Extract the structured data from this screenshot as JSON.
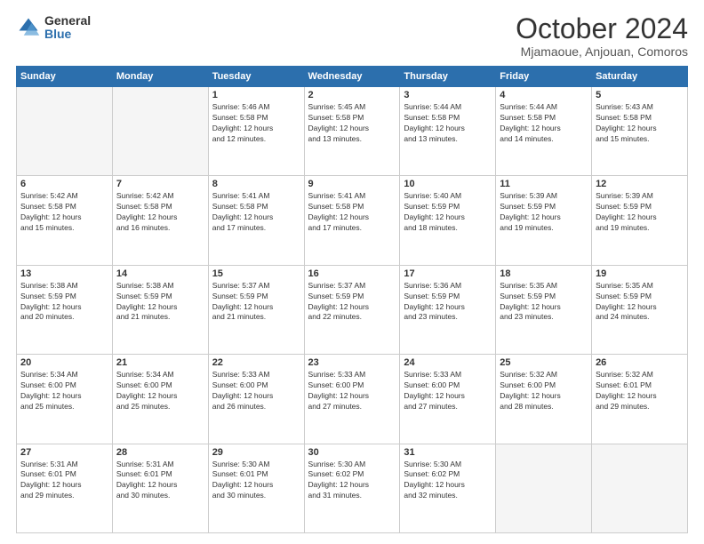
{
  "logo": {
    "general": "General",
    "blue": "Blue"
  },
  "title": {
    "month_year": "October 2024",
    "location": "Mjamaoue, Anjouan, Comoros"
  },
  "weekdays": [
    "Sunday",
    "Monday",
    "Tuesday",
    "Wednesday",
    "Thursday",
    "Friday",
    "Saturday"
  ],
  "weeks": [
    [
      {
        "day": "",
        "details": ""
      },
      {
        "day": "",
        "details": ""
      },
      {
        "day": "1",
        "details": "Sunrise: 5:46 AM\nSunset: 5:58 PM\nDaylight: 12 hours\nand 12 minutes."
      },
      {
        "day": "2",
        "details": "Sunrise: 5:45 AM\nSunset: 5:58 PM\nDaylight: 12 hours\nand 13 minutes."
      },
      {
        "day": "3",
        "details": "Sunrise: 5:44 AM\nSunset: 5:58 PM\nDaylight: 12 hours\nand 13 minutes."
      },
      {
        "day": "4",
        "details": "Sunrise: 5:44 AM\nSunset: 5:58 PM\nDaylight: 12 hours\nand 14 minutes."
      },
      {
        "day": "5",
        "details": "Sunrise: 5:43 AM\nSunset: 5:58 PM\nDaylight: 12 hours\nand 15 minutes."
      }
    ],
    [
      {
        "day": "6",
        "details": "Sunrise: 5:42 AM\nSunset: 5:58 PM\nDaylight: 12 hours\nand 15 minutes."
      },
      {
        "day": "7",
        "details": "Sunrise: 5:42 AM\nSunset: 5:58 PM\nDaylight: 12 hours\nand 16 minutes."
      },
      {
        "day": "8",
        "details": "Sunrise: 5:41 AM\nSunset: 5:58 PM\nDaylight: 12 hours\nand 17 minutes."
      },
      {
        "day": "9",
        "details": "Sunrise: 5:41 AM\nSunset: 5:58 PM\nDaylight: 12 hours\nand 17 minutes."
      },
      {
        "day": "10",
        "details": "Sunrise: 5:40 AM\nSunset: 5:59 PM\nDaylight: 12 hours\nand 18 minutes."
      },
      {
        "day": "11",
        "details": "Sunrise: 5:39 AM\nSunset: 5:59 PM\nDaylight: 12 hours\nand 19 minutes."
      },
      {
        "day": "12",
        "details": "Sunrise: 5:39 AM\nSunset: 5:59 PM\nDaylight: 12 hours\nand 19 minutes."
      }
    ],
    [
      {
        "day": "13",
        "details": "Sunrise: 5:38 AM\nSunset: 5:59 PM\nDaylight: 12 hours\nand 20 minutes."
      },
      {
        "day": "14",
        "details": "Sunrise: 5:38 AM\nSunset: 5:59 PM\nDaylight: 12 hours\nand 21 minutes."
      },
      {
        "day": "15",
        "details": "Sunrise: 5:37 AM\nSunset: 5:59 PM\nDaylight: 12 hours\nand 21 minutes."
      },
      {
        "day": "16",
        "details": "Sunrise: 5:37 AM\nSunset: 5:59 PM\nDaylight: 12 hours\nand 22 minutes."
      },
      {
        "day": "17",
        "details": "Sunrise: 5:36 AM\nSunset: 5:59 PM\nDaylight: 12 hours\nand 23 minutes."
      },
      {
        "day": "18",
        "details": "Sunrise: 5:35 AM\nSunset: 5:59 PM\nDaylight: 12 hours\nand 23 minutes."
      },
      {
        "day": "19",
        "details": "Sunrise: 5:35 AM\nSunset: 5:59 PM\nDaylight: 12 hours\nand 24 minutes."
      }
    ],
    [
      {
        "day": "20",
        "details": "Sunrise: 5:34 AM\nSunset: 6:00 PM\nDaylight: 12 hours\nand 25 minutes."
      },
      {
        "day": "21",
        "details": "Sunrise: 5:34 AM\nSunset: 6:00 PM\nDaylight: 12 hours\nand 25 minutes."
      },
      {
        "day": "22",
        "details": "Sunrise: 5:33 AM\nSunset: 6:00 PM\nDaylight: 12 hours\nand 26 minutes."
      },
      {
        "day": "23",
        "details": "Sunrise: 5:33 AM\nSunset: 6:00 PM\nDaylight: 12 hours\nand 27 minutes."
      },
      {
        "day": "24",
        "details": "Sunrise: 5:33 AM\nSunset: 6:00 PM\nDaylight: 12 hours\nand 27 minutes."
      },
      {
        "day": "25",
        "details": "Sunrise: 5:32 AM\nSunset: 6:00 PM\nDaylight: 12 hours\nand 28 minutes."
      },
      {
        "day": "26",
        "details": "Sunrise: 5:32 AM\nSunset: 6:01 PM\nDaylight: 12 hours\nand 29 minutes."
      }
    ],
    [
      {
        "day": "27",
        "details": "Sunrise: 5:31 AM\nSunset: 6:01 PM\nDaylight: 12 hours\nand 29 minutes."
      },
      {
        "day": "28",
        "details": "Sunrise: 5:31 AM\nSunset: 6:01 PM\nDaylight: 12 hours\nand 30 minutes."
      },
      {
        "day": "29",
        "details": "Sunrise: 5:30 AM\nSunset: 6:01 PM\nDaylight: 12 hours\nand 30 minutes."
      },
      {
        "day": "30",
        "details": "Sunrise: 5:30 AM\nSunset: 6:02 PM\nDaylight: 12 hours\nand 31 minutes."
      },
      {
        "day": "31",
        "details": "Sunrise: 5:30 AM\nSunset: 6:02 PM\nDaylight: 12 hours\nand 32 minutes."
      },
      {
        "day": "",
        "details": ""
      },
      {
        "day": "",
        "details": ""
      }
    ]
  ]
}
